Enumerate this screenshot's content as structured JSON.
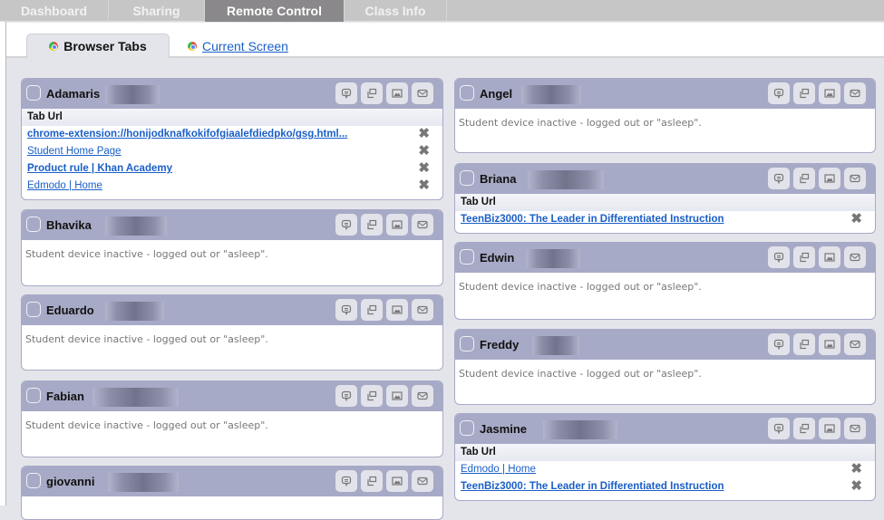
{
  "nav": {
    "tabs": [
      {
        "label": "Dashboard",
        "active": false
      },
      {
        "label": "Sharing",
        "active": false
      },
      {
        "label": "Remote Control",
        "active": true
      },
      {
        "label": "Class Info",
        "active": false
      }
    ]
  },
  "subtabs": {
    "browser_tabs": "Browser Tabs",
    "current_screen": "Current Screen"
  },
  "labels": {
    "tab_url_header": "Tab Url",
    "inactive_message": "Student device inactive - logged out or \"asleep\".",
    "close_glyph": "✖"
  },
  "icons": {
    "message": "message-icon",
    "window": "open-window-icon",
    "screenshot": "screenshot-icon",
    "email": "email-icon",
    "close": "close-tab-icon"
  },
  "students": {
    "adamaris": {
      "name": "Adamaris",
      "tabs": [
        "chrome-extension://honijodknafkokifofgiaalefdiedpko/gsg.html...",
        "Student Home Page",
        "Product rule | Khan Academy",
        "Edmodo | Home"
      ]
    },
    "bhavika": {
      "name": "Bhavika"
    },
    "eduardo": {
      "name": "Eduardo"
    },
    "fabian": {
      "name": "Fabian"
    },
    "giovanni": {
      "name": "giovanni"
    },
    "angel": {
      "name": "Angel"
    },
    "briana": {
      "name": "Briana",
      "tabs": [
        "TeenBiz3000: The Leader in Differentiated Instruction"
      ]
    },
    "edwin": {
      "name": "Edwin"
    },
    "freddy": {
      "name": "Freddy"
    },
    "jasmine": {
      "name": "Jasmine",
      "tabs": [
        "Edmodo | Home",
        "TeenBiz3000: The Leader in Differentiated Instruction"
      ]
    }
  }
}
